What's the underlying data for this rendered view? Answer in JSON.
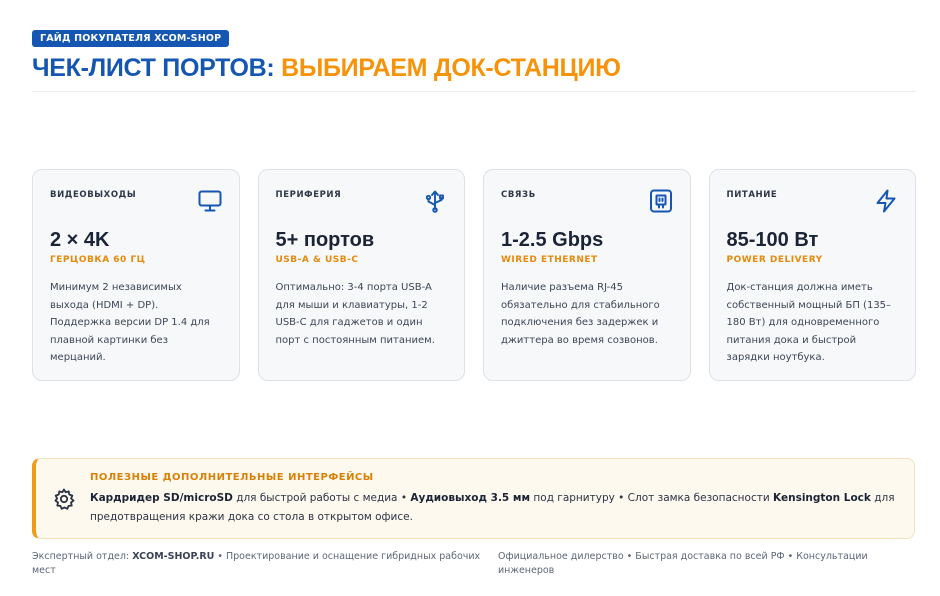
{
  "header": {
    "badge": "ГАЙД ПОКУПАТЕЛЯ XCOM-SHOP",
    "title_part1": "ЧЕК-ЛИСТ ПОРТОВ:",
    "title_part2": "ВЫБИРАЕМ ДОК-СТАНЦИЮ"
  },
  "cards": [
    {
      "label": "ВИДЕОВЫХОДЫ",
      "icon": "monitor-icon",
      "value": "2 × 4K",
      "sub": "ГЕРЦОВКА 60 ГЦ",
      "desc": "Минимум 2 независимых выхода (HDMI + DP). Поддержка версии DP 1.4 для плавной картинки без мерцаний."
    },
    {
      "label": "ПЕРИФЕРИЯ",
      "icon": "usb-icon",
      "value": "5+ портов",
      "sub": "USB-A & USB-C",
      "desc": "Оптимально: 3-4 порта USB-A для мыши и клавиатуры, 1-2 USB-C для гаджетов и один порт с постоянным питанием."
    },
    {
      "label": "СВЯЗЬ",
      "icon": "ethernet-icon",
      "value": "1-2.5 Gbps",
      "sub": "WIRED ETHERNET",
      "desc": "Наличие разъема RJ-45 обязательно для стабильного подключения без задержек и джиттера во время созвонов."
    },
    {
      "label": "ПИТАНИЕ",
      "icon": "lightning-icon",
      "value": "85-100 Вт",
      "sub": "POWER DELIVERY",
      "desc": "Док-станция должна иметь собственный мощный БП (135–180 Вт) для одновременного питания дока и быстрой зарядки ноутбука."
    }
  ],
  "note": {
    "icon": "gear-icon",
    "title": "ПОЛЕЗНЫЕ ДОПОЛНИТЕЛЬНЫЕ ИНТЕРФЕЙСЫ",
    "item1_bold": "Кардридер SD/microSD",
    "item1_text": " для быстрой работы с медиа • ",
    "item2_bold": "Аудиовыход 3.5 мм",
    "item2_text": " под гарнитуру • Слот замка безопасности ",
    "item3_bold": "Kensington Lock",
    "item3_text": " для предотвращения кражи дока со стола в открытом офисе."
  },
  "footer": {
    "left_prefix": "Экспертный отдел: ",
    "left_brand": "XCOM-SHOP.RU",
    "left_suffix": " • Проектирование и оснащение гибридных рабочих мест",
    "right": "Официальное дилерство • Быстрая доставка по всей РФ • Консультации инженеров"
  },
  "colors": {
    "brand_blue": "#1456b2",
    "accent_orange": "#f5930b",
    "note_bg": "#fdf9ee"
  }
}
